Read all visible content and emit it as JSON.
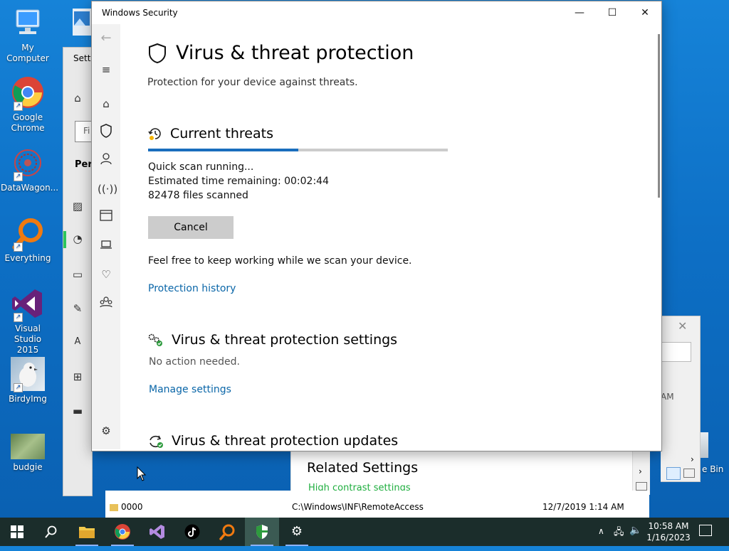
{
  "desktop": {
    "icons": [
      {
        "label": "My Computer"
      },
      {
        "label": "Google\nChrome"
      },
      {
        "label": "DataWagon..."
      },
      {
        "label": "Everything"
      },
      {
        "label": "Visual Studio\n2015"
      },
      {
        "label": "BirdyImg"
      },
      {
        "label": "budgie"
      }
    ],
    "recycle_label": "e Bin"
  },
  "settings_window": {
    "title_partial": "Setti",
    "search_partial": "Fi",
    "section_partial": "Pers"
  },
  "windows_security": {
    "title": "Windows Security",
    "page_title": "Virus & threat protection",
    "page_subtitle": "Protection for your device against threats.",
    "current_threats": {
      "heading": "Current threats",
      "progress_fraction": 0.5,
      "status": "Quick scan running...",
      "time_remaining": "Estimated time remaining:  00:02:44",
      "files_scanned": "82478 files scanned",
      "cancel_label": "Cancel",
      "keep_working": "Feel free to keep working while we scan your device.",
      "history_link": "Protection history"
    },
    "settings_section": {
      "heading": "Virus & threat protection settings",
      "status": "No action needed.",
      "manage_link": "Manage settings"
    },
    "updates_section": {
      "heading": "Virus & threat protection updates"
    }
  },
  "lower_window": {
    "heading": "Related Settings",
    "link": "High contrast settings"
  },
  "explorer_rows": [
    {
      "name": "0000",
      "path": "C:\\Windows\\INF\\RemoteAccess",
      "date": "12/7/2019 1:14 AM"
    }
  ],
  "right_dialog": {
    "partial_text": "AM"
  },
  "taskbar": {
    "time": "10:58 AM",
    "date": "1/16/2023"
  },
  "colors": {
    "accent": "#0a66a8",
    "progress": "#1a6ebd",
    "taskbar": "#1b2d2b"
  }
}
